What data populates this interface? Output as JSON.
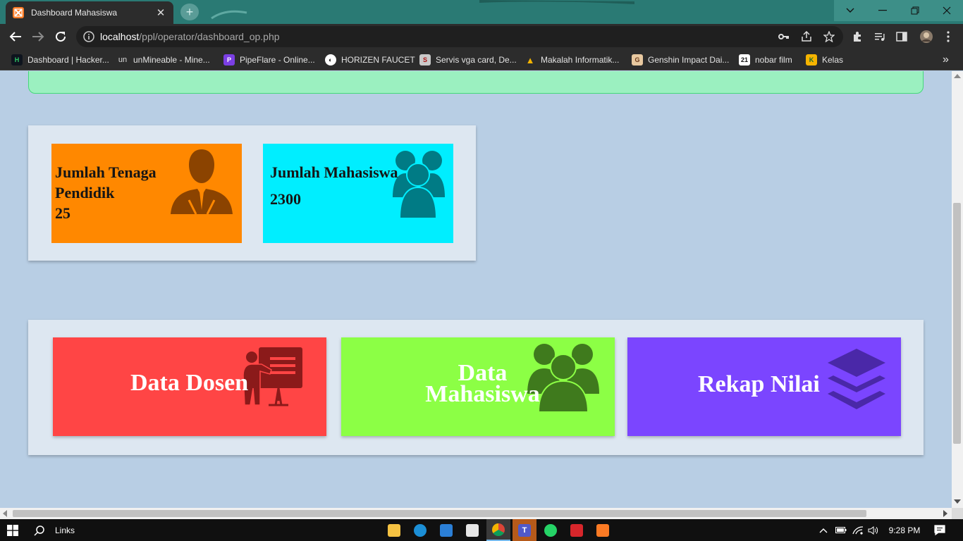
{
  "browser": {
    "tab_title": "Dashboard Mahasiswa",
    "url_host": "localhost",
    "url_path": "/ppl/operator/dashboard_op.php",
    "close_glyph": "✕",
    "newtab_glyph": "+",
    "overflow_glyph": "»"
  },
  "bookmarks": [
    {
      "label": "Dashboard | Hacker...",
      "icon": "hackerrank-icon",
      "color": "#2ec866",
      "glyph": "H"
    },
    {
      "label": "unMineable - Mine...",
      "icon": "unmineable-icon",
      "color": "#2c2c2c",
      "glyph": "un"
    },
    {
      "label": "PipeFlare - Online...",
      "icon": "pipeflare-icon",
      "color": "#7b3fe4",
      "glyph": "P"
    },
    {
      "label": "HORIZEN FAUCET",
      "icon": "horizen-icon",
      "color": "#ffffff",
      "glyph": "◐"
    },
    {
      "label": "Servis vga card, De...",
      "icon": "servis-icon",
      "color": "#c9c9c9",
      "glyph": "S"
    },
    {
      "label": "Makalah Informatik...",
      "icon": "google-drive-icon",
      "color": "#f4b400",
      "glyph": "▲"
    },
    {
      "label": "Genshin Impact Dai...",
      "icon": "genshin-icon",
      "color": "#e8c9a0",
      "glyph": "G"
    },
    {
      "label": "nobar film",
      "icon": "film-icon",
      "color": "#ffffff",
      "glyph": "21"
    },
    {
      "label": "Kelas",
      "icon": "classroom-icon",
      "color": "#f6b400",
      "glyph": "K"
    }
  ],
  "stats": {
    "tendik": {
      "label_line1": "Jumlah Tenaga",
      "label_line2": "Pendidik",
      "value": "25",
      "color": "#ff8800"
    },
    "mahasiswa": {
      "label": "Jumlah Mahasiswa",
      "value": "2300",
      "color": "#00eeff"
    }
  },
  "menu": {
    "dosen": {
      "label": "Data Dosen",
      "color": "#ff4545"
    },
    "mahasiswa": {
      "label_line1": "Data",
      "label_line2": "Mahasiswa",
      "color": "#8cff45"
    },
    "rekap": {
      "label": "Rekap Nilai",
      "color": "#7b45ff"
    }
  },
  "taskbar": {
    "search_label": "Links",
    "time": "9:28 PM"
  }
}
